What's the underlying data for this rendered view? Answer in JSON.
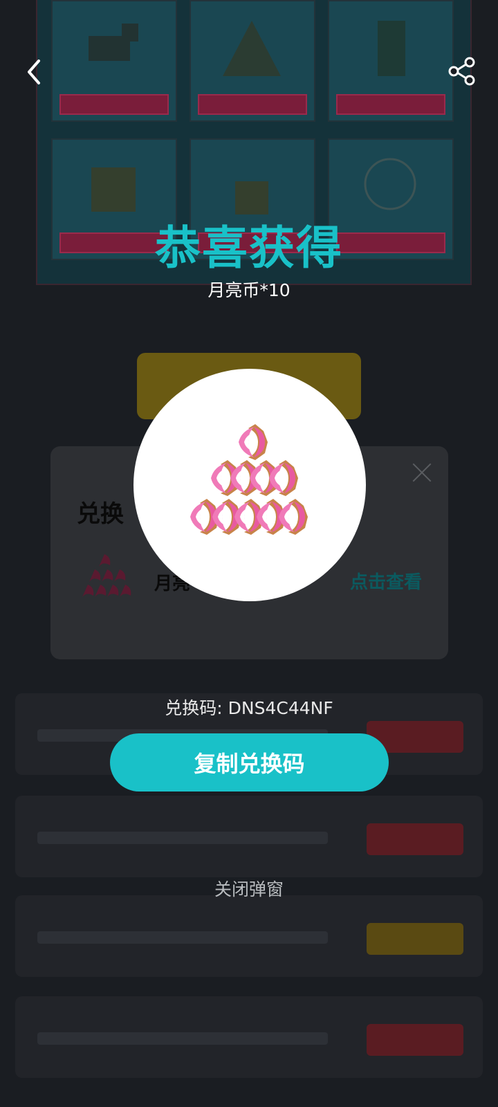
{
  "topbar": {
    "back_icon": "chevron-left-icon",
    "share_icon": "share-icon"
  },
  "popup": {
    "title": "恭喜获得",
    "reward": "月亮币*10",
    "prize_icon": "moon-coin-pile-icon",
    "redeem_code": "兑换码: DNS4C44NF",
    "copy_button": "复制兑换码",
    "close_label": "关闭弹窗"
  },
  "exchange_card": {
    "title": "兑换",
    "item_name": "月亮",
    "view_link": "点击查看"
  },
  "colors": {
    "accent": "#19c1c8",
    "overlay": "#111419",
    "white": "#ffffff"
  }
}
